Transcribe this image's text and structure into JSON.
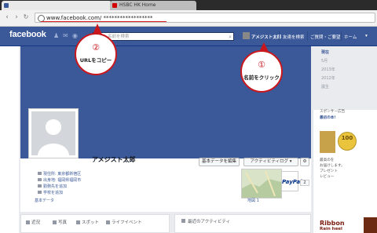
{
  "browser": {
    "tab_active_title": "",
    "tab_inactive_title": "HSBC HK Home",
    "url_text": "www.facebook.com/ ******************"
  },
  "fb_nav": {
    "logo": "facebook",
    "search_placeholder": "名前を検索",
    "profile_name": "アメジスト太郎",
    "links": [
      "友達を検索",
      "ご質問・ご要望",
      "ホーム"
    ]
  },
  "profile": {
    "name": "アメジスト太郎",
    "buttons": {
      "edit": "基本データを編集",
      "activity_log": "アクティビティログ",
      "count": "2"
    },
    "info": [
      "現住所: 東京都新宿区",
      "出身地: 福岡県福岡市",
      "勤務先を追加",
      "学校を追加"
    ],
    "basic_data": "基本データ",
    "map_label": "地図 1",
    "paypal": "PayPal"
  },
  "subtabs": [
    "近況",
    "写真",
    "スポット",
    "ライフイベント"
  ],
  "activity_header": "最近のアクティビティ",
  "years": [
    "現在",
    "5月",
    "2013年",
    "2012年",
    "誕生"
  ],
  "ads": {
    "sponsor": "スポンサー広告",
    "title": "最初の本!",
    "lines": [
      "最高のを",
      "お届けします。",
      "プレゼント",
      "レビュー"
    ],
    "badge": "100",
    "ribbon": "Ribbon",
    "ribbon_sub": "Rain heel"
  },
  "callouts": [
    {
      "num": "②",
      "text": "URLをコピー"
    },
    {
      "num": "①",
      "text": "名前をクリック"
    }
  ],
  "colors": {
    "fb_blue": "#3b5998",
    "callout_red": "#c9171e"
  }
}
